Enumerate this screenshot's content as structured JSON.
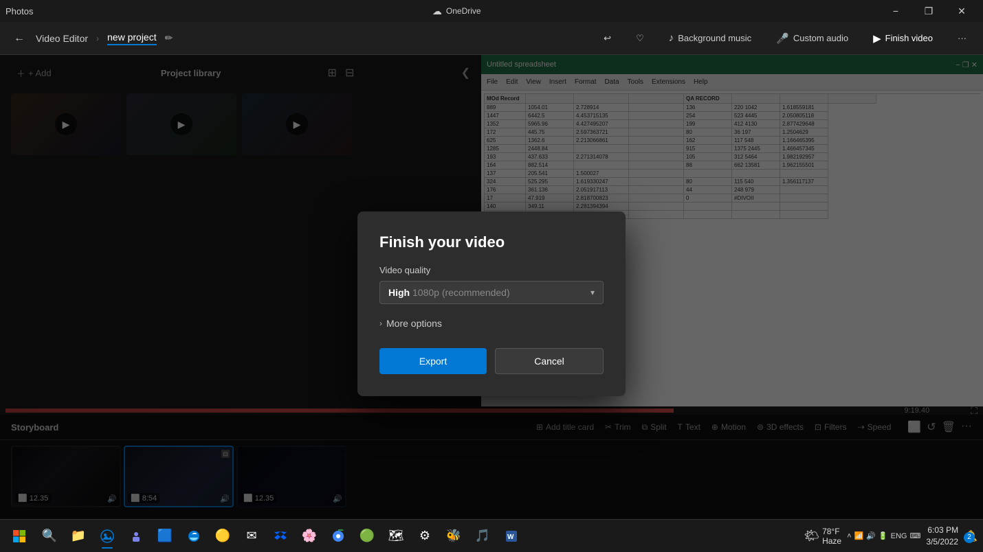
{
  "titlebar": {
    "app_name": "Photos",
    "onedrive_label": "OneDrive",
    "min_label": "−",
    "max_label": "❐",
    "close_label": "✕"
  },
  "toolbar": {
    "back_label": "←",
    "app_title": "Video Editor",
    "breadcrumb_sep": "›",
    "project_name": "new project",
    "edit_icon": "✏",
    "undo_label": "↩",
    "favorite_label": "♡",
    "bg_music_label": "Background music",
    "custom_audio_label": "Custom audio",
    "finish_video_label": "Finish video",
    "more_label": "···"
  },
  "project_library": {
    "title": "Project library",
    "add_label": "+ Add",
    "grid_icon_4": "⊞",
    "grid_icon_9": "⊟",
    "collapse_icon": "❮"
  },
  "storyboard": {
    "title": "Storyboard",
    "add_title_card": "Add title card",
    "trim": "Trim",
    "split": "Split",
    "text": "Text",
    "motion": "Motion",
    "effects_3d": "3D effects",
    "filters": "Filters",
    "speed": "Speed",
    "timeline": "9:19.40",
    "clips": [
      {
        "duration": "12.35",
        "has_audio": true,
        "selected": false
      },
      {
        "duration": "8:54",
        "has_audio": true,
        "selected": true
      },
      {
        "duration": "12.35",
        "has_audio": true,
        "selected": false
      }
    ]
  },
  "modal": {
    "title": "Finish your video",
    "quality_label": "Video quality",
    "quality_value": "High",
    "quality_resolution": "1080p (recommended)",
    "more_options_label": "More options",
    "export_label": "Export",
    "cancel_label": "Cancel"
  },
  "taskbar": {
    "weather_temp": "78°F",
    "weather_condition": "Haze",
    "time": "6:03 PM",
    "date": "3/5/2022",
    "language": "ENG",
    "notification_count": "2"
  }
}
